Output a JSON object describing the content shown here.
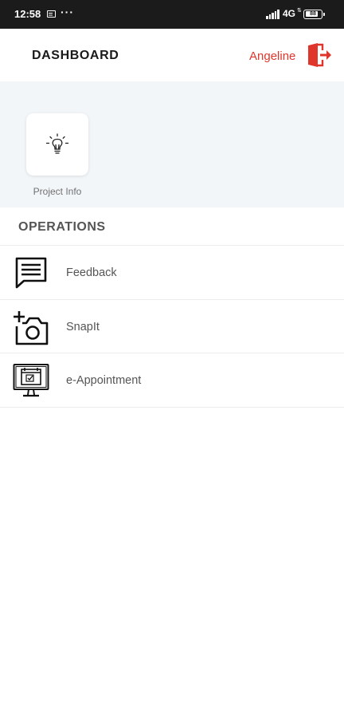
{
  "status_bar": {
    "time": "12:58",
    "overflow": "···",
    "network": "4G",
    "arrows": "⇅",
    "battery_text": "88",
    "battery_level": 0.88
  },
  "header": {
    "title": "DASHBOARD",
    "user_name": "Angeline",
    "logout_icon": "logout-door-icon",
    "accent_color": "#e0352b"
  },
  "tiles": [
    {
      "label": "Project Info",
      "icon": "lightbulb-icon"
    }
  ],
  "operations": {
    "title": "OPERATIONS",
    "items": [
      {
        "label": "Feedback",
        "icon": "chat-bubble-icon"
      },
      {
        "label": "SnapIt",
        "icon": "add-camera-icon"
      },
      {
        "label": "e-Appointment",
        "icon": "monitor-calendar-icon"
      }
    ]
  }
}
